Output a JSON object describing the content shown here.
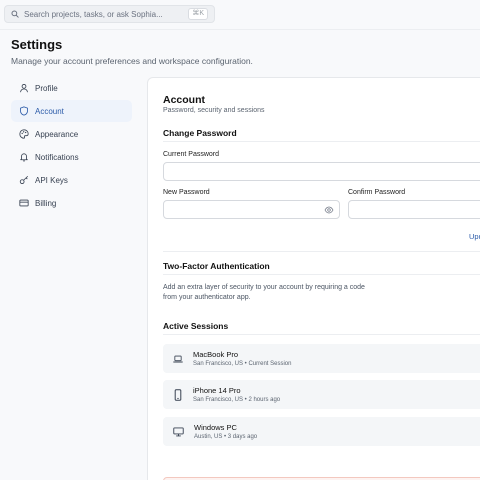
{
  "search": {
    "placeholder": "Search projects, tasks, or ask Sophia...",
    "shortcut": "⌘K"
  },
  "header": {
    "title": "Settings",
    "subtitle": "Manage your account preferences and workspace configuration."
  },
  "nav": {
    "items": [
      {
        "label": "Profile",
        "icon": "user-icon",
        "active": false
      },
      {
        "label": "Account",
        "icon": "shield-icon",
        "active": true
      },
      {
        "label": "Appearance",
        "icon": "palette-icon",
        "active": false
      },
      {
        "label": "Notifications",
        "icon": "bell-icon",
        "active": false
      },
      {
        "label": "API Keys",
        "icon": "key-icon",
        "active": false
      },
      {
        "label": "Billing",
        "icon": "credit-card-icon",
        "active": false
      }
    ]
  },
  "account": {
    "title": "Account",
    "subtitle": "Password, security and sessions",
    "change_password": {
      "title": "Change Password",
      "current_label": "Current Password",
      "new_label": "New Password",
      "confirm_label": "Confirm Password",
      "update_label": "Upd"
    },
    "two_factor": {
      "title": "Two-Factor Authentication",
      "description_1": "Add an extra layer of security to your account by requiring a code",
      "description_2": "from your authenticator app."
    },
    "sessions": {
      "title": "Active Sessions",
      "items": [
        {
          "device": "MacBook Pro",
          "meta": "San Francisco, US • Current Session",
          "icon": "laptop-icon"
        },
        {
          "device": "iPhone 14 Pro",
          "meta": "San Francisco, US • 2 hours ago",
          "icon": "phone-icon"
        },
        {
          "device": "Windows PC",
          "meta": "Austin, US • 3 days ago",
          "icon": "monitor-icon"
        }
      ]
    }
  },
  "colors": {
    "accent": "#2a5aa8",
    "active_bg": "#eef3fb",
    "danger_border": "#f3c8bf"
  }
}
